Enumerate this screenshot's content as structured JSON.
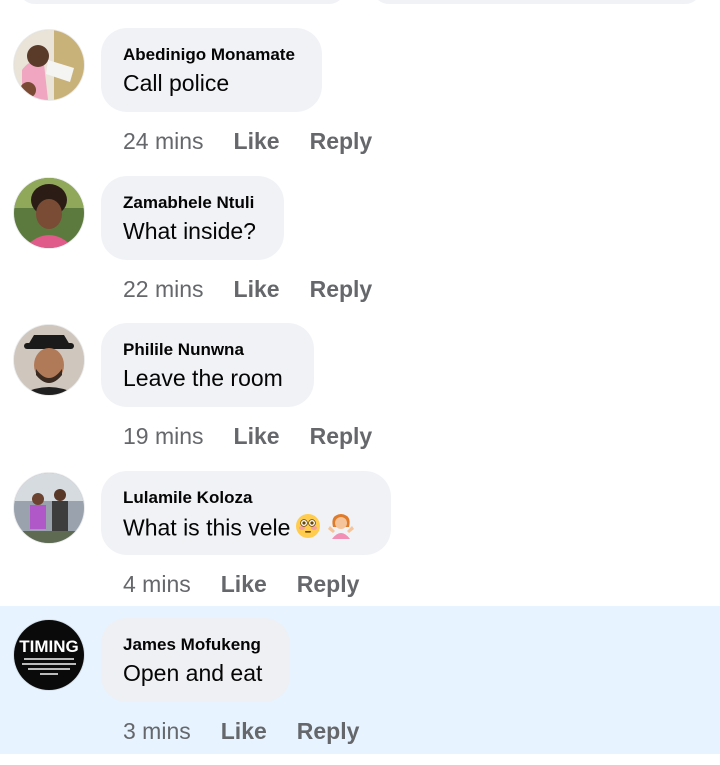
{
  "comments": [
    {
      "author": "Abedinigo Monamate",
      "text": "Call police",
      "time": "24 mins",
      "like": "Like",
      "reply": "Reply"
    },
    {
      "author": "Zamabhele Ntuli",
      "text": "What inside?",
      "time": "22 mins",
      "like": "Like",
      "reply": "Reply"
    },
    {
      "author": "Philile Nunwna",
      "text": "Leave the room",
      "time": "19 mins",
      "like": "Like",
      "reply": "Reply"
    },
    {
      "author": "Lulamile Koloza",
      "text": "What is this vele",
      "emojis": [
        "flushed-face-emoji",
        "woman-shrugging-emoji"
      ],
      "time": "4 mins",
      "like": "Like",
      "reply": "Reply"
    },
    {
      "author": "James Mofukeng",
      "text": "Open and eat",
      "time": "3 mins",
      "like": "Like",
      "reply": "Reply",
      "avatar_text": "TIMING"
    }
  ],
  "colors": {
    "bubble": "#f0f2f5",
    "highlight": "#e7f3ff",
    "meta_text": "#65676b",
    "author_text": "#050505"
  }
}
